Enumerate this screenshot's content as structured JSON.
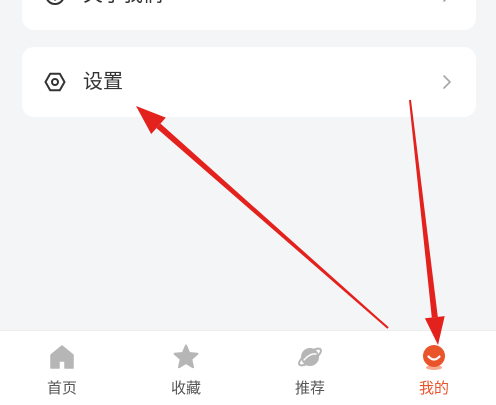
{
  "menu": {
    "items": [
      {
        "label": "关于我们",
        "icon": "info-circle-icon"
      },
      {
        "label": "设置",
        "icon": "hexagon-settings-icon"
      }
    ],
    "chevron_icon": "chevron-right-icon"
  },
  "tabbar": {
    "items": [
      {
        "label": "首页",
        "icon": "home-icon",
        "active": false
      },
      {
        "label": "收藏",
        "icon": "star-icon",
        "active": false
      },
      {
        "label": "推荐",
        "icon": "planet-icon",
        "active": false
      },
      {
        "label": "我的",
        "icon": "avatar-icon",
        "active": true
      }
    ]
  },
  "colors": {
    "background": "#f4f5f7",
    "card": "#ffffff",
    "active": "#e9542b",
    "inactive_text": "#555555",
    "inactive_icon": "#b6b6b6",
    "text": "#333333",
    "annotation_arrow": "#e3211d"
  }
}
